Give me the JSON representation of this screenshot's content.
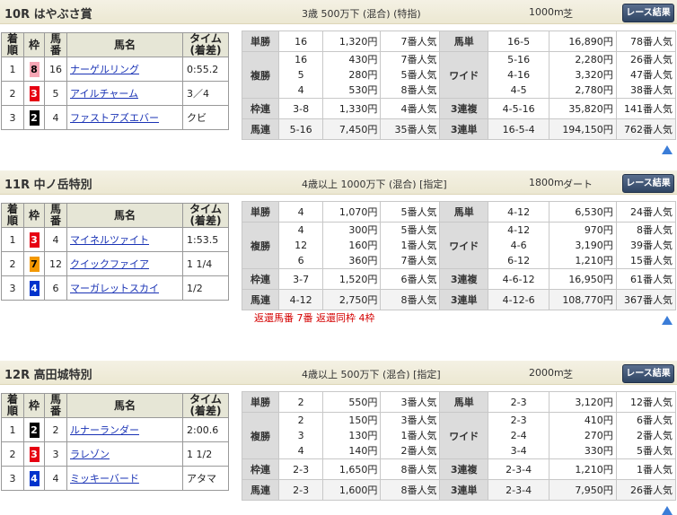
{
  "headers": {
    "rank": "着順",
    "gate": "枠",
    "horse_no": "馬番",
    "horse": "馬名",
    "time": "タイム(着差)",
    "rank2": "着順",
    "time_line1": "タイム",
    "time_line2": "(着差)"
  },
  "results_label": "レース結果",
  "gate_colors": {
    "1": "#ffffff",
    "2": "#000000",
    "3": "#e60012",
    "4": "#0033cc",
    "5": "#ffe800",
    "6": "#009944",
    "7": "#f39800",
    "8": "#f6a5b4"
  },
  "gate_text_colors": {
    "1": "#000",
    "2": "#fff",
    "3": "#fff",
    "4": "#fff",
    "5": "#000",
    "6": "#fff",
    "7": "#000",
    "8": "#000"
  },
  "races": [
    {
      "name": "10R はやぶさ賞",
      "conditions": "3歳 500万下 (混合) (特指)",
      "distance": "1000m",
      "surface": "芝",
      "results": [
        {
          "rank": "1",
          "gate": "8",
          "no": "16",
          "horse": "ナーゲルリング",
          "time": "0:55.2"
        },
        {
          "rank": "2",
          "gate": "3",
          "no": "5",
          "horse": "アイルチャーム",
          "time": "3／4"
        },
        {
          "rank": "3",
          "gate": "2",
          "no": "4",
          "horse": "ファストアズエバー",
          "time": "クビ"
        }
      ],
      "win": {
        "label": "単勝",
        "no": "16",
        "amount": "1,320円",
        "pop": "7番人気"
      },
      "place": {
        "label": "複勝",
        "nos": [
          "16",
          "5",
          "4"
        ],
        "amounts": [
          "430円",
          "280円",
          "530円"
        ],
        "pops": [
          "7番人気",
          "5番人気",
          "8番人気"
        ]
      },
      "bracket": {
        "label": "枠連",
        "no": "3-8",
        "amount": "1,330円",
        "pop": "4番人気"
      },
      "quinella": {
        "label": "馬連",
        "no": "5-16",
        "amount": "7,450円",
        "pop": "35番人気"
      },
      "exacta": {
        "label": "馬単",
        "no": "16-5",
        "amount": "16,890円",
        "pop": "78番人気"
      },
      "wide": {
        "label": "ワイド",
        "nos": [
          "5-16",
          "4-16",
          "4-5"
        ],
        "amounts": [
          "2,280円",
          "3,320円",
          "2,780円"
        ],
        "pops": [
          "26番人気",
          "47番人気",
          "38番人気"
        ]
      },
      "trio": {
        "label": "3連複",
        "no": "4-5-16",
        "amount": "35,820円",
        "pop": "141番人気"
      },
      "trifecta": {
        "label": "3連単",
        "no": "16-5-4",
        "amount": "194,150円",
        "pop": "762番人気"
      },
      "note": ""
    },
    {
      "name": "11R 中ノ岳特別",
      "conditions": "4歳以上 1000万下 (混合) [指定]",
      "distance": "1800m",
      "surface": "ダート",
      "results": [
        {
          "rank": "1",
          "gate": "3",
          "no": "4",
          "horse": "マイネルツァイト",
          "time": "1:53.5"
        },
        {
          "rank": "2",
          "gate": "7",
          "no": "12",
          "horse": "クイックファイア",
          "time": "1 1/4"
        },
        {
          "rank": "3",
          "gate": "4",
          "no": "6",
          "horse": "マーガレットスカイ",
          "time": "1/2"
        }
      ],
      "win": {
        "label": "単勝",
        "no": "4",
        "amount": "1,070円",
        "pop": "5番人気"
      },
      "place": {
        "label": "複勝",
        "nos": [
          "4",
          "12",
          "6"
        ],
        "amounts": [
          "300円",
          "160円",
          "360円"
        ],
        "pops": [
          "5番人気",
          "1番人気",
          "7番人気"
        ]
      },
      "bracket": {
        "label": "枠連",
        "no": "3-7",
        "amount": "1,520円",
        "pop": "6番人気"
      },
      "quinella": {
        "label": "馬連",
        "no": "4-12",
        "amount": "2,750円",
        "pop": "8番人気"
      },
      "exacta": {
        "label": "馬単",
        "no": "4-12",
        "amount": "6,530円",
        "pop": "24番人気"
      },
      "wide": {
        "label": "ワイド",
        "nos": [
          "4-12",
          "4-6",
          "6-12"
        ],
        "amounts": [
          "970円",
          "3,190円",
          "1,210円"
        ],
        "pops": [
          "8番人気",
          "39番人気",
          "15番人気"
        ]
      },
      "trio": {
        "label": "3連複",
        "no": "4-6-12",
        "amount": "16,950円",
        "pop": "61番人気"
      },
      "trifecta": {
        "label": "3連単",
        "no": "4-12-6",
        "amount": "108,770円",
        "pop": "367番人気"
      },
      "note": "返還馬番 7番 返還同枠 4枠"
    },
    {
      "name": "12R 高田城特別",
      "conditions": "4歳以上 500万下 (混合) [指定]",
      "distance": "2000m",
      "surface": "芝",
      "results": [
        {
          "rank": "1",
          "gate": "2",
          "no": "2",
          "horse": "ルナーランダー",
          "time": "2:00.6"
        },
        {
          "rank": "2",
          "gate": "3",
          "no": "3",
          "horse": "ラレゾン",
          "time": "1 1/2"
        },
        {
          "rank": "3",
          "gate": "4",
          "no": "4",
          "horse": "ミッキーバード",
          "time": "アタマ"
        }
      ],
      "win": {
        "label": "単勝",
        "no": "2",
        "amount": "550円",
        "pop": "3番人気"
      },
      "place": {
        "label": "複勝",
        "nos": [
          "2",
          "3",
          "4"
        ],
        "amounts": [
          "150円",
          "130円",
          "140円"
        ],
        "pops": [
          "3番人気",
          "1番人気",
          "2番人気"
        ]
      },
      "bracket": {
        "label": "枠連",
        "no": "2-3",
        "amount": "1,650円",
        "pop": "8番人気"
      },
      "quinella": {
        "label": "馬連",
        "no": "2-3",
        "amount": "1,600円",
        "pop": "8番人気"
      },
      "exacta": {
        "label": "馬単",
        "no": "2-3",
        "amount": "3,120円",
        "pop": "12番人気"
      },
      "wide": {
        "label": "ワイド",
        "nos": [
          "2-3",
          "2-4",
          "3-4"
        ],
        "amounts": [
          "410円",
          "270円",
          "330円"
        ],
        "pops": [
          "6番人気",
          "2番人気",
          "5番人気"
        ]
      },
      "trio": {
        "label": "3連複",
        "no": "2-3-4",
        "amount": "1,210円",
        "pop": "1番人気"
      },
      "trifecta": {
        "label": "3連単",
        "no": "2-3-4",
        "amount": "7,950円",
        "pop": "26番人気"
      },
      "note": ""
    }
  ]
}
